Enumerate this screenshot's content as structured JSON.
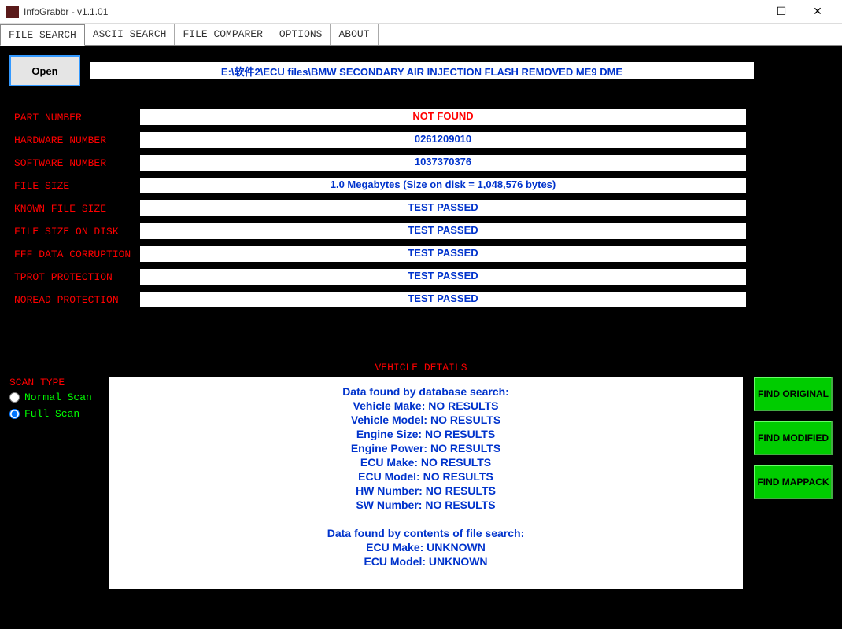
{
  "window": {
    "title": "InfoGrabbr - v1.1.01"
  },
  "menu": {
    "file_search": "FILE SEARCH",
    "ascii_search": "ASCII SEARCH",
    "file_comparer": "FILE COMPARER",
    "options": "OPTIONS",
    "about": "ABOUT"
  },
  "main": {
    "open_label": "Open",
    "path": "E:\\软件2\\ECU files\\BMW SECONDARY AIR INJECTION FLASH REMOVED ME9 DME",
    "rows": {
      "part_number": {
        "label": "PART NUMBER",
        "value": "NOT FOUND"
      },
      "hardware_number": {
        "label": "HARDWARE NUMBER",
        "value": "0261209010"
      },
      "software_number": {
        "label": "SOFTWARE NUMBER",
        "value": "1037370376"
      },
      "file_size": {
        "label": "FILE SIZE",
        "value": "1.0 Megabytes (Size on disk = 1,048,576 bytes)"
      },
      "known_file_size": {
        "label": "KNOWN FILE SIZE",
        "value": "TEST PASSED"
      },
      "file_size_on_disk": {
        "label": "FILE SIZE ON DISK",
        "value": "TEST PASSED"
      },
      "fff_data_corruption": {
        "label": "FFF DATA CORRUPTION",
        "value": "TEST PASSED"
      },
      "tprot_protection": {
        "label": "TPROT PROTECTION",
        "value": "TEST PASSED"
      },
      "noread_protection": {
        "label": "NOREAD PROTECTION",
        "value": "TEST PASSED"
      }
    }
  },
  "details": {
    "header": "VEHICLE DETAILS",
    "lines": [
      "Data found by database search:",
      "Vehicle Make: NO RESULTS",
      "Vehicle Model: NO RESULTS",
      "Engine Size: NO RESULTS",
      "Engine Power: NO RESULTS",
      "ECU Make: NO RESULTS",
      "ECU Model: NO RESULTS",
      "HW Number: NO RESULTS",
      "SW Number: NO RESULTS",
      "",
      "Data found by contents of file search:",
      "ECU Make: UNKNOWN",
      "ECU Model: UNKNOWN"
    ]
  },
  "scan": {
    "title": "SCAN TYPE",
    "normal": "Normal Scan",
    "full": "Full Scan"
  },
  "buttons": {
    "find_original": "FIND ORIGINAL",
    "find_modified": "FIND MODIFIED",
    "find_mappack": "FIND MAPPACK"
  }
}
